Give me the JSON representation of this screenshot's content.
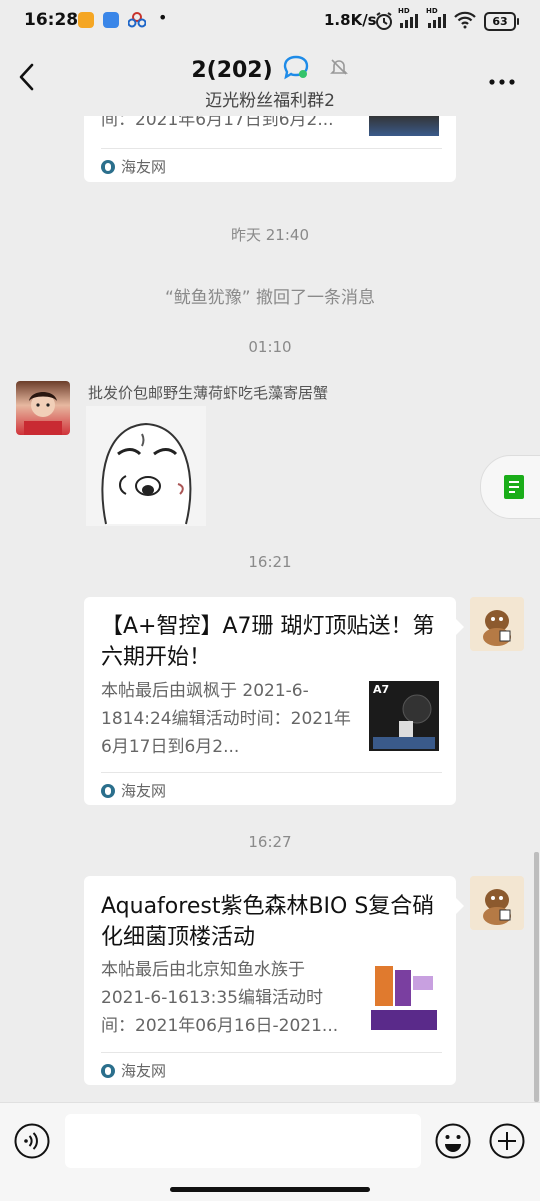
{
  "status": {
    "time": "16:28",
    "network_speed": "1.8K/s",
    "battery": "63",
    "dot": "•",
    "hd_badge": "HD"
  },
  "header": {
    "title": "2(202)",
    "subtitle": "迈光粉丝福利群2"
  },
  "messages": {
    "card_top": {
      "desc_last": "间：2021年6月17日到6月2...",
      "source": "海友网"
    },
    "time1": "昨天 21:40",
    "recall_text": "“鱿鱼犹豫” 撤回了一条消息",
    "time2": "01:10",
    "sender_name": "批发价包邮野生薄荷虾吃毛藻寄居蟹",
    "time3": "16:21",
    "card_a7": {
      "title": "【A+智控】A7珊 瑚灯顶贴送！第六期开始！",
      "desc": "本帖最后由飒枫于 2021-6-1814:24编辑活动时间：2021年6月17日到6月2...",
      "source": "海友网",
      "thumb_label": "A7"
    },
    "time4": "16:27",
    "card_aqua": {
      "title": "Aquaforest紫色森林BIO S复合硝化细菌顶楼活动",
      "desc": "本帖最后由北京知鱼水族于 2021-6-1613:35编辑活动时间：2021年06月16日-2021...",
      "source": "海友网"
    }
  },
  "input": {
    "placeholder": ""
  },
  "colors": {
    "background": "#ededed",
    "card": "#ffffff",
    "meta_text": "#8a8a8a",
    "float_icon": "#1aad19"
  }
}
